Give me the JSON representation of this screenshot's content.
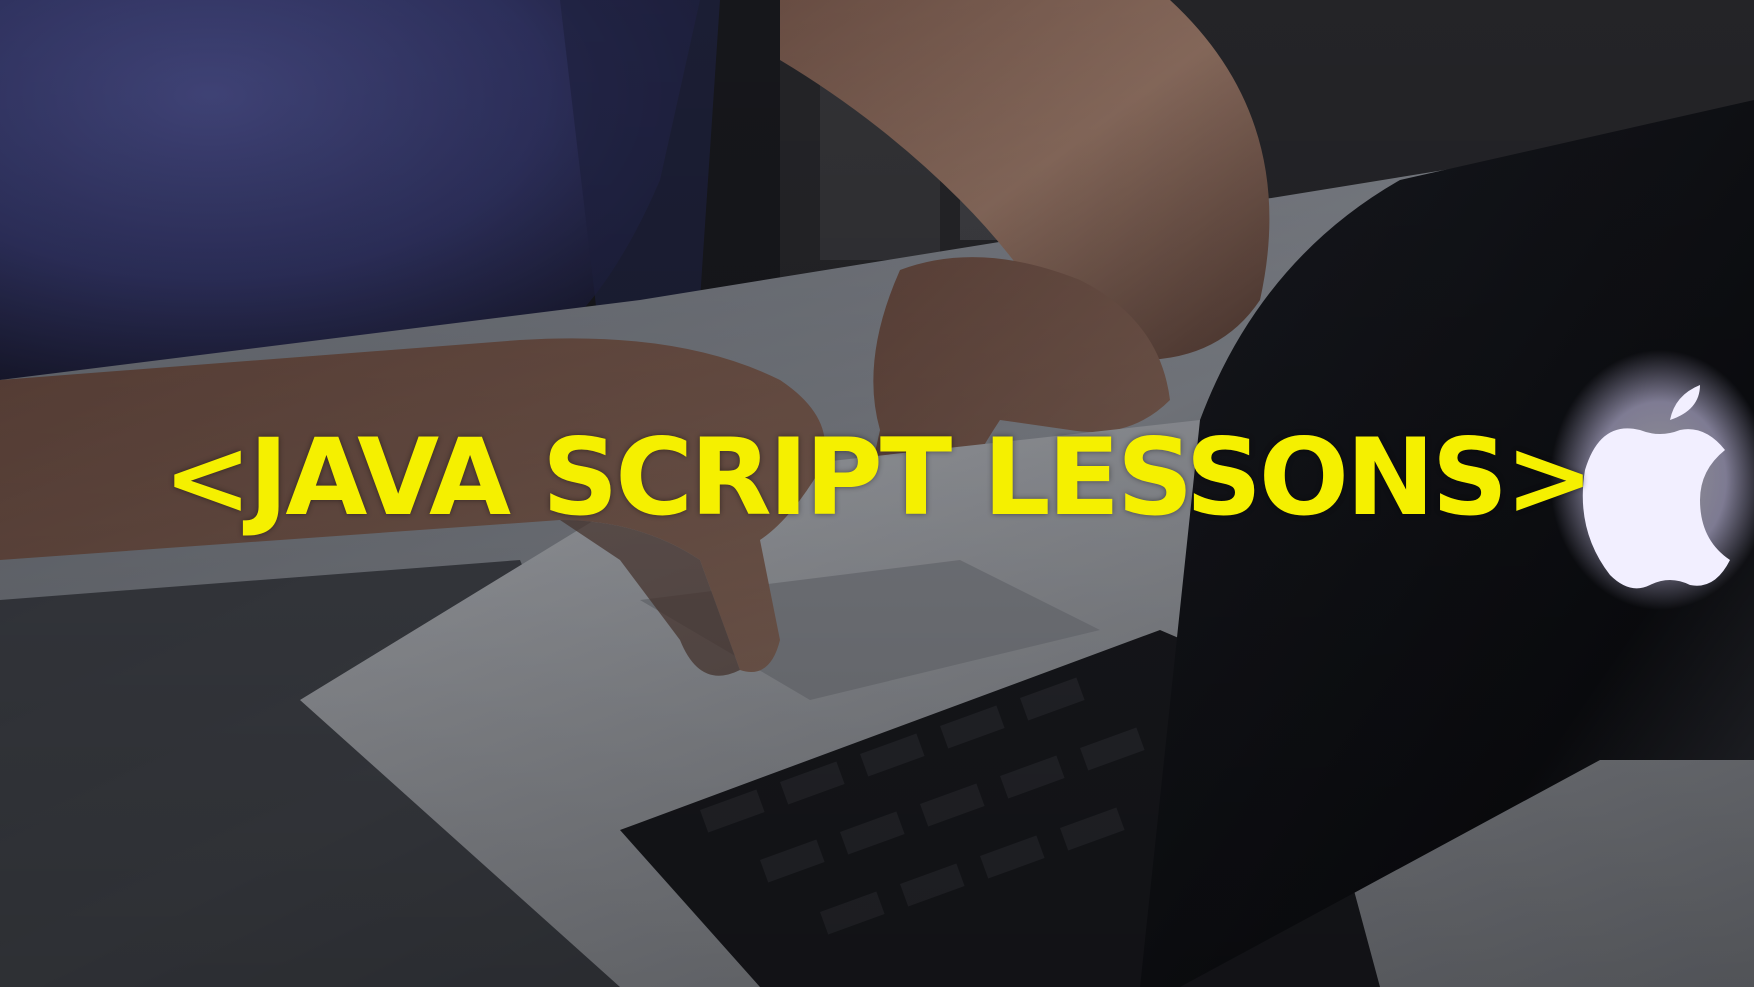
{
  "title": {
    "text": "<JAVA SCRIPT LESSONS>",
    "color": "#f5f000"
  },
  "scene": {
    "icons": [
      "apple-logo-icon"
    ],
    "colors": {
      "shirt": "#3b3f74",
      "skin": "#8a6a5c",
      "desk": "#9a9ea6",
      "laptop_body": "#b4b7bd",
      "laptop_lid": "#0f1116",
      "logo_glow": "#e9e6ff"
    }
  }
}
